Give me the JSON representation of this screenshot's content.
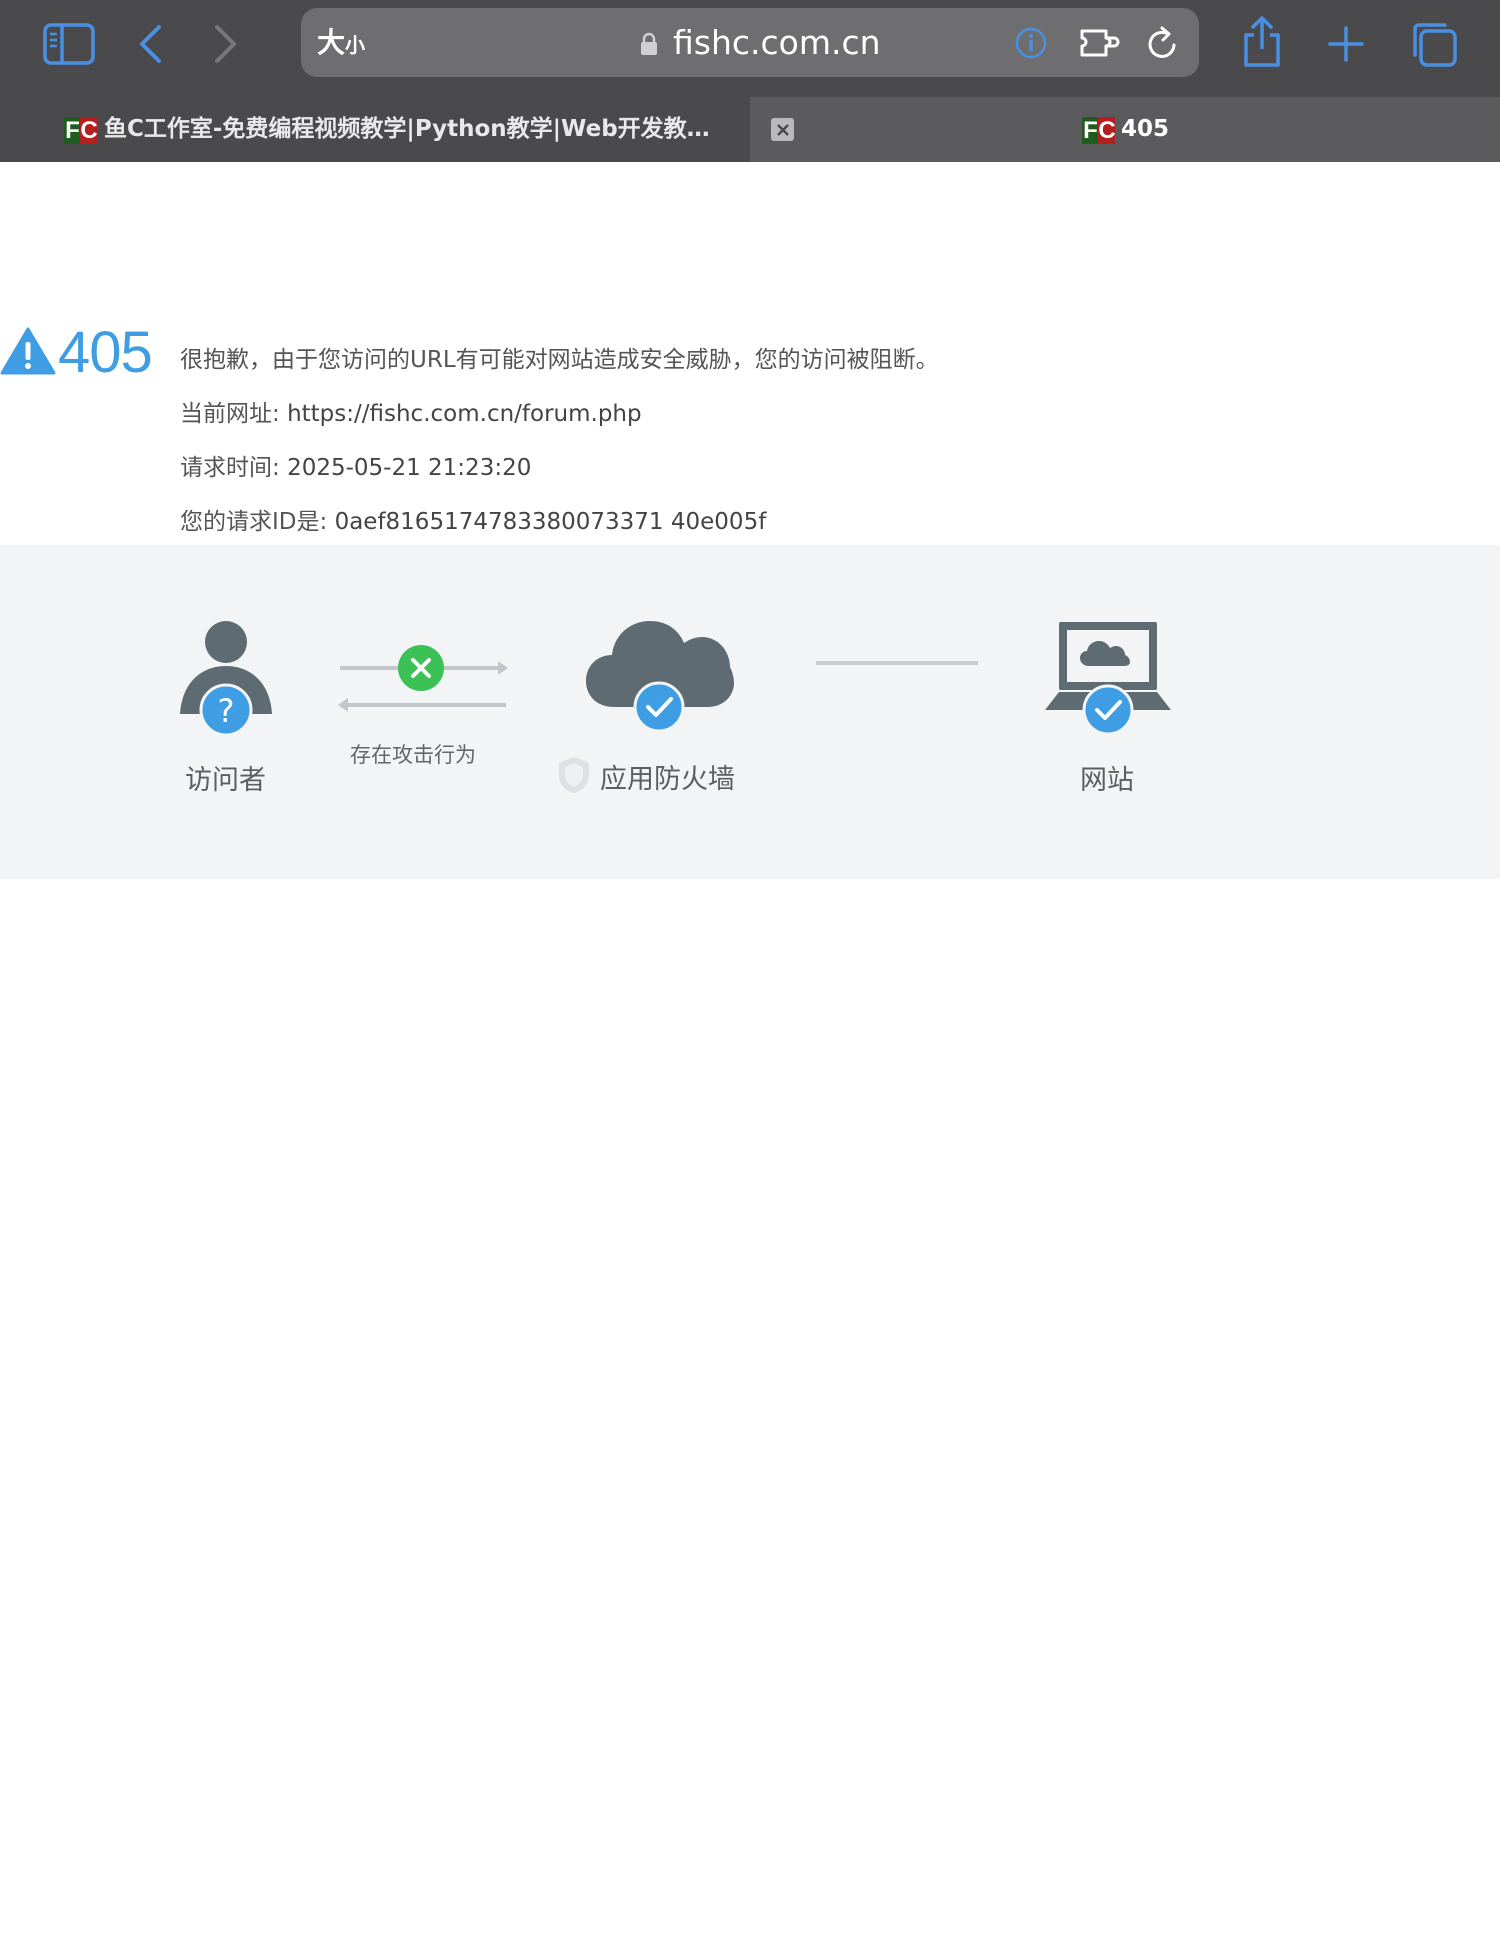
{
  "browser": {
    "address_bar": {
      "text_size_large": "大",
      "text_size_small": "小",
      "host": "fishc.com.cn"
    },
    "tabs": [
      {
        "favicon_left": "F",
        "favicon_right": "C",
        "title": "鱼C工作室-免费编程视频教学|Python教学|Web开发教…",
        "active": true
      },
      {
        "favicon_left": "F",
        "favicon_right": "C",
        "title": "405",
        "active": false
      }
    ],
    "icons": [
      "sidebar-icon",
      "back-icon",
      "forward-icon",
      "lock-icon",
      "info-icon",
      "extension-icon",
      "reload-icon",
      "share-icon",
      "new-tab-icon",
      "tab-overview-icon",
      "close-icon"
    ],
    "accent_color": "#4a90e2"
  },
  "error": {
    "code": "405",
    "message": "很抱歉，由于您访问的URL有可能对网站造成安全威胁，您的访问被阻断。",
    "url_label": "当前网址: ",
    "url_value": "https://fishc.com.cn/forum.php",
    "time_label": "请求时间: ",
    "time_value": "2025-05-21 21:23:20",
    "id_label": "您的请求ID是: ",
    "id_value": "0aef8165174783380073371 40e005f",
    "accent_color": "#3f9ee3"
  },
  "diagram": {
    "visitor_label": "访问者",
    "attack_label": "存在攻击行为",
    "firewall_label": "应用防火墙",
    "website_label": "网站",
    "status_colors": {
      "blocked": "#3cc157",
      "ok": "#3f9ee3"
    }
  }
}
